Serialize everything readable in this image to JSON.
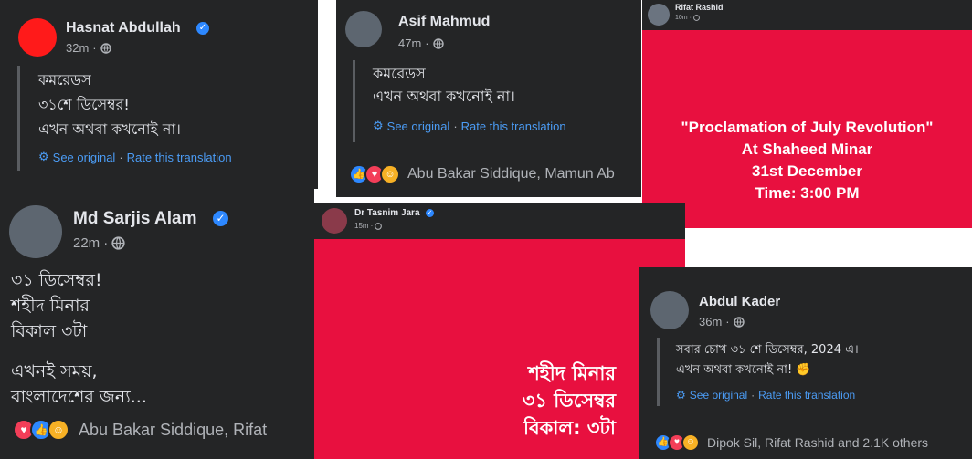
{
  "posts": {
    "hasnat": {
      "author": "Hasnat Abdullah",
      "time": "32m",
      "text": "কমরেডস\n৩১শে ডিসেম্বর!\nএখন অথবা কখনোই না।",
      "see_original": "See original",
      "rate": "Rate this translation"
    },
    "asif": {
      "author": "Asif Mahmud",
      "time": "47m",
      "text": "কমরেডস\nএখন অথবা কখনোই না।",
      "see_original": "See original",
      "rate": "Rate this translation",
      "reactions": "Abu Bakar Siddique, Mamun Ab"
    },
    "rifat": {
      "author": "Rifat Rashid",
      "time": "10m",
      "slide_text": "\"Proclamation of July Revolution\"\nAt Shaheed Minar\n31st December\nTime: 3:00 PM"
    },
    "sarjis": {
      "author": "Md Sarjis Alam",
      "time": "22m",
      "text1": "৩১ ডিসেম্বর!\nশহীদ মিনার\nবিকাল ৩টা",
      "text2": "এখনই সময়,\nবাংলাদেশের জন্য...",
      "reactions": "Abu Bakar Siddique, Rifat"
    },
    "tasnim": {
      "author": "Dr Tasnim Jara",
      "time": "15m",
      "slide_text": "শহীদ মিনার\n৩১ ডিসেম্বর\nবিকাল: ৩টা"
    },
    "kader": {
      "author": "Abdul Kader",
      "time": "36m",
      "text": "সবার চোখ ৩১ শে ডিসেম্বর, 2024 এ।\nএখন অথবা কখনোই না! ✊",
      "see_original": "See original",
      "rate": "Rate this translation",
      "reactions": "Dipok Sil, Rifat Rashid and 2.1K others"
    }
  },
  "separator": "·",
  "colors": {
    "panel_bg": "#242526",
    "slide_red": "#e8103f",
    "link_blue": "#4b9cf5",
    "verified_blue": "#2d88ff"
  },
  "icons": [
    "globe-icon",
    "verified-icon",
    "gear-icon",
    "like-icon",
    "love-icon",
    "care-icon"
  ]
}
